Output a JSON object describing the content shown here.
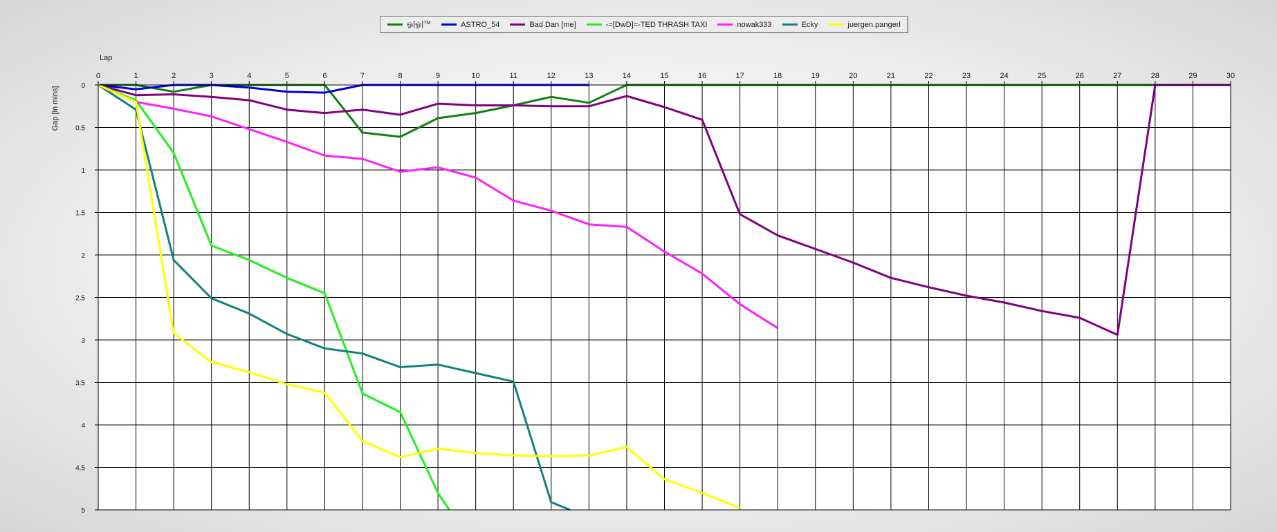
{
  "chart_data": {
    "type": "line",
    "xlabel": "Lap",
    "ylabel": "Gap [in mins]",
    "xlim": [
      0,
      30
    ],
    "ylim": [
      0,
      5
    ],
    "y_inverted": true,
    "grid": true,
    "legend_position": "top-center",
    "x_ticks": [
      0,
      1,
      2,
      3,
      4,
      5,
      6,
      7,
      8,
      9,
      10,
      11,
      12,
      13,
      14,
      15,
      16,
      17,
      18,
      19,
      20,
      21,
      22,
      23,
      24,
      25,
      26,
      27,
      28,
      29,
      30
    ],
    "y_ticks": [
      0,
      0.5,
      1,
      1.5,
      2,
      2.5,
      3,
      3.5,
      4,
      4.5,
      5
    ],
    "y_tick_labels": [
      "0",
      "0.5",
      "1",
      "1.5",
      "2",
      "2.5",
      "3",
      "3.5",
      "4",
      "4.5",
      "5"
    ],
    "series": [
      {
        "name": "ஓ|ஓ|™",
        "color": "#108010",
        "x": [
          0,
          1,
          2,
          3,
          4,
          5,
          6,
          7,
          8,
          9,
          10,
          11,
          12,
          13,
          14,
          15,
          16,
          17,
          18,
          19,
          20,
          21,
          22,
          23,
          24,
          25,
          26,
          27,
          28,
          29,
          30
        ],
        "y": [
          0,
          0,
          0.08,
          0,
          0,
          0,
          0,
          0.56,
          0.61,
          0.39,
          0.33,
          0.24,
          0.14,
          0.21,
          0,
          0,
          0,
          0,
          0,
          0,
          0,
          0,
          0,
          0,
          0,
          0,
          0,
          0,
          0,
          0,
          0
        ]
      },
      {
        "name": "ASTRO_54",
        "color": "#0000e0",
        "x": [
          0,
          1,
          2,
          3,
          4,
          5,
          6,
          7,
          8,
          9,
          10,
          11,
          12,
          13
        ],
        "y": [
          0,
          0.05,
          0,
          0,
          0.03,
          0.08,
          0.09,
          0,
          0,
          0,
          0,
          0,
          0,
          0
        ]
      },
      {
        "name": "Bad Dan [me]",
        "color": "#800080",
        "x": [
          0,
          1,
          2,
          3,
          4,
          5,
          6,
          7,
          8,
          9,
          10,
          11,
          12,
          13,
          14,
          15,
          16,
          17,
          18,
          19,
          20,
          21,
          22,
          23,
          24,
          25,
          26,
          27,
          28,
          29,
          30
        ],
        "y": [
          0,
          0.12,
          0.11,
          0.14,
          0.18,
          0.29,
          0.33,
          0.29,
          0.35,
          0.22,
          0.24,
          0.24,
          0.25,
          0.25,
          0.13,
          0.26,
          0.41,
          1.52,
          1.77,
          1.93,
          2.09,
          2.27,
          2.38,
          2.48,
          2.56,
          2.66,
          2.74,
          2.94,
          0,
          0,
          0
        ]
      },
      {
        "name": "-=[DwD]=-TED THRASH TAXI",
        "color": "#20f020",
        "x": [
          0,
          1,
          2,
          3,
          4,
          5,
          6,
          7,
          8,
          9,
          9.3
        ],
        "y": [
          0,
          0.18,
          0.8,
          1.89,
          2.06,
          2.27,
          2.45,
          3.63,
          3.85,
          4.8,
          5
        ]
      },
      {
        "name": "nowak333",
        "color": "#ff20ff",
        "x": [
          0,
          1,
          2,
          3,
          4,
          5,
          6,
          7,
          8,
          9,
          10,
          11,
          12,
          13,
          14,
          15,
          16,
          17,
          18
        ],
        "y": [
          0,
          0.2,
          0.28,
          0.37,
          0.52,
          0.67,
          0.83,
          0.87,
          1.02,
          0.97,
          1.09,
          1.36,
          1.48,
          1.64,
          1.67,
          1.96,
          2.22,
          2.58,
          2.86
        ]
      },
      {
        "name": "Ecky",
        "color": "#108080",
        "x": [
          0,
          1,
          2,
          3,
          4,
          5,
          6,
          7,
          8,
          9,
          10,
          11,
          12,
          12.5
        ],
        "y": [
          0,
          0.29,
          2.06,
          2.51,
          2.69,
          2.93,
          3.1,
          3.16,
          3.32,
          3.29,
          3.39,
          3.49,
          4.91,
          5
        ]
      },
      {
        "name": "juergen.pangerl",
        "color": "#ffff00",
        "x": [
          0,
          1,
          2,
          3,
          4,
          5,
          6,
          7,
          8,
          9,
          10,
          11,
          12,
          13,
          14,
          15,
          16,
          17
        ],
        "y": [
          0,
          0.2,
          2.92,
          3.26,
          3.38,
          3.52,
          3.62,
          4.19,
          4.38,
          4.28,
          4.33,
          4.36,
          4.37,
          4.36,
          4.26,
          4.64,
          4.8,
          4.98
        ]
      }
    ]
  }
}
